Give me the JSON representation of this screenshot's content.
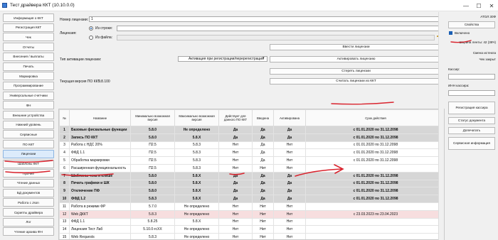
{
  "window": {
    "title": "Тест драйвера ККТ (10.10.0.0)",
    "controls": [
      "—",
      "☐",
      "✕"
    ]
  },
  "sidebar": {
    "items": [
      {
        "label": "Информация о ККТ"
      },
      {
        "label": "Регистрация ККТ"
      },
      {
        "label": "Чек"
      },
      {
        "label": "Отчеты"
      },
      {
        "label": "Внесения / выплаты"
      },
      {
        "label": "Печать"
      },
      {
        "label": "Маркировка"
      },
      {
        "label": "Программирование"
      },
      {
        "label": "Универсальные счетчики"
      },
      {
        "label": "ФН"
      },
      {
        "label": "Внешние устройства"
      },
      {
        "label": "Нижний уровень"
      },
      {
        "label": "Сервисные"
      },
      {
        "label": "ПО ККТ"
      },
      {
        "label": "Лицензии",
        "active": true
      },
      {
        "label": "Шаблоны ККТ"
      },
      {
        "label": "Прочее"
      },
      {
        "label": "Чтение данных"
      },
      {
        "label": "БД документов"
      },
      {
        "label": "Работа с Json"
      },
      {
        "label": "Скрипты драйвера"
      },
      {
        "label": "Лог"
      },
      {
        "label": "Чтение архива ФН"
      }
    ]
  },
  "form": {
    "license_number_label": "Номер лицензии:",
    "license_number_value": "1",
    "from_string_label": "Из строки:",
    "license_label": "Лицензия:",
    "from_file_label": "Из файла:",
    "enter_licenses_button": "Ввести лицензии",
    "activation_type_label": "Тип активации лицензии:",
    "activation_type_value": "Активация при регистрации/перерегистрации",
    "activate_button": "Активировать лицензию",
    "erase_button": "Стереть лицензии",
    "current_version_label": "Текущая версия ПО ККТ:",
    "current_version_value": "5.8.100",
    "read_licenses_button": "Считать лицензии из ККТ"
  },
  "table": {
    "headers": [
      "№",
      "Название",
      "Минимально возможная версия",
      "Максимально возможная версия",
      "Действует для данного ПО ККТ",
      "Введена",
      "Активирована",
      "Срок действия"
    ],
    "rows": [
      {
        "n": "1",
        "name": "Базовые фискальные функции",
        "min": "5.8.0",
        "max": "Не определено",
        "valid": "Да",
        "entered": "Да",
        "activated": "Да",
        "period": "с 01.01.2020 по 31.12.2098",
        "style": "g"
      },
      {
        "n": "2",
        "name": "Запись ПО ККТ",
        "min": "5.8.0",
        "max": "5.8.X",
        "valid": "Да",
        "entered": "Да",
        "activated": "Да",
        "period": "с 01.01.2020 по 31.12.2098",
        "style": "g"
      },
      {
        "n": "3",
        "name": "Работа с НДС 20%",
        "min": "П2.5",
        "max": "5.8.3",
        "valid": "Нет",
        "entered": "Да",
        "activated": "Нет",
        "period": "с 01.01.2020 по 31.12.2098",
        "style": "w"
      },
      {
        "n": "4",
        "name": "ФФД 1.1",
        "min": "П2.5",
        "max": "5.8.3",
        "valid": "Нет",
        "entered": "Да",
        "activated": "Нет",
        "period": "с 01.01.2020 по 31.12.2098",
        "style": "w"
      },
      {
        "n": "5",
        "name": "Обработка маркировки",
        "min": "П2.5",
        "max": "5.8.3",
        "valid": "Нет",
        "entered": "Да",
        "activated": "Нет",
        "period": "с 01.01.2020 по 31.12.2098",
        "style": "w"
      },
      {
        "n": "6",
        "name": "Расширенная функциональность",
        "min": "П2.5",
        "max": "5.8.3",
        "valid": "Нет",
        "entered": "Нет",
        "activated": "Нет",
        "period": "",
        "style": "w"
      },
      {
        "n": "7",
        "name": "Шаблоны чека и клише",
        "min": "5.8.0",
        "max": "5.8.X",
        "valid": "Да",
        "entered": "Да",
        "activated": "Да",
        "period": "с 01.01.2020 по 31.12.2098",
        "style": "g"
      },
      {
        "n": "8",
        "name": "Печать графики и ШК",
        "min": "5.8.0",
        "max": "5.8.X",
        "valid": "Да",
        "entered": "Да",
        "activated": "Да",
        "period": "с 01.01.2020 по 31.12.2098",
        "style": "g"
      },
      {
        "n": "9",
        "name": "Отключение ПФ",
        "min": "5.8.0",
        "max": "5.8.X",
        "valid": "Да",
        "entered": "Да",
        "activated": "Да",
        "period": "с 01.01.2020 по 31.12.2098",
        "style": "g"
      },
      {
        "n": "10",
        "name": "ФФД 1.2",
        "min": "5.8.3",
        "max": "5.8.X",
        "valid": "Да",
        "entered": "Да",
        "activated": "Да",
        "period": "с 01.01.2020 по 31.12.2098",
        "style": "g"
      },
      {
        "n": "11",
        "name": "Работа в режиме ФР",
        "min": "5.7.0",
        "max": "Не определено",
        "valid": "Нет",
        "entered": "Нет",
        "activated": "Нет",
        "period": "",
        "style": "w"
      },
      {
        "n": "12",
        "name": "Web ДККТ",
        "min": "5.8.3",
        "max": "Не определено",
        "valid": "Нет",
        "entered": "Нет",
        "activated": "Нет",
        "period": "с 23.03.2023 по 23.04.2023",
        "style": "p"
      },
      {
        "n": "13",
        "name": "ФФД 1.1",
        "min": "5.8.25",
        "max": "5.8.X",
        "valid": "Нет",
        "entered": "Нет",
        "activated": "Нет",
        "period": "",
        "style": "w"
      },
      {
        "n": "14",
        "name": "Лицензия Тест Лаб",
        "min": "5.10.0-rcXX",
        "max": "Не определено",
        "valid": "Нет",
        "entered": "Нет",
        "activated": "Нет",
        "period": "",
        "style": "w"
      },
      {
        "n": "15",
        "name": "Web Requests",
        "min": "5.8.3",
        "max": "Не определено",
        "valid": "Нет",
        "entered": "Нет",
        "activated": "Нет",
        "period": "",
        "style": "w"
      },
      {
        "n": "16",
        "name": "Релизная лицензия",
        "min": "5.10.0",
        "max": "Не определено",
        "valid": "Нет",
        "entered": "Нет",
        "activated": "Нет",
        "period": "",
        "style": "w"
      }
    ]
  },
  "rightpanel": {
    "device_name": "АТОЛ 30Ф",
    "properties_button": "Свойства",
    "enabled_label": "Включено",
    "tape_width": "Ширина ленты: 42 (38Ч)",
    "shift_expired": "Смена истекла",
    "receipt_closed": "Чек закрыт",
    "cashier_label": "Кассир:",
    "inn_label": "ИНН кассира:",
    "reg_cashier_button": "Регистрация кассира",
    "doc_status_button": "Статус документа",
    "print_button": "Допечатать",
    "service_info_button": "Сервисная информация"
  },
  "colors": {
    "annotation": "#d9232d",
    "active_nav": "#dcebfb",
    "group_row": "#d6d6d6",
    "expired_row": "#f7dedf",
    "accent": "#1a5fb4"
  }
}
